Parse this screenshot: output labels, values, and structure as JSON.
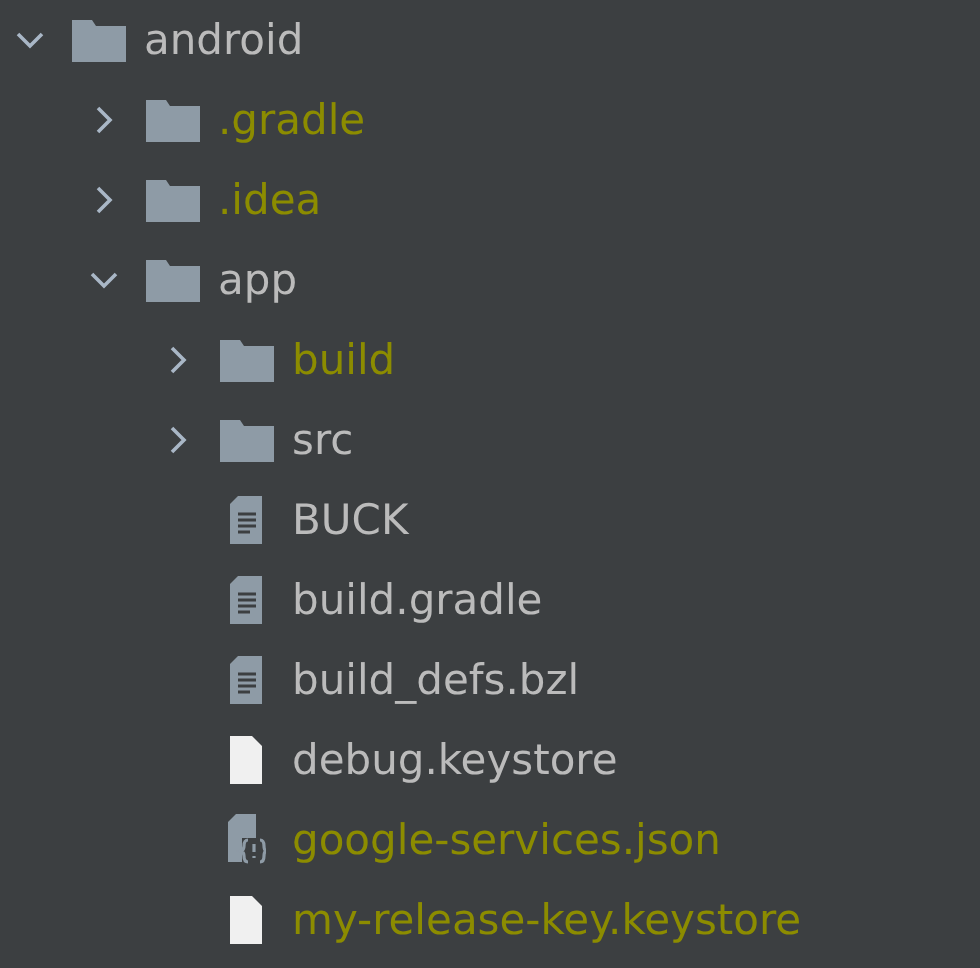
{
  "tree": [
    {
      "kind": "folder",
      "name": "android",
      "expanded": true,
      "ignored": false,
      "children": [
        {
          "kind": "folder",
          "name": ".gradle",
          "expanded": false,
          "ignored": true
        },
        {
          "kind": "folder",
          "name": ".idea",
          "expanded": false,
          "ignored": true
        },
        {
          "kind": "folder",
          "name": "app",
          "expanded": true,
          "ignored": false,
          "children": [
            {
              "kind": "folder",
              "name": "build",
              "expanded": false,
              "ignored": true
            },
            {
              "kind": "folder",
              "name": "src",
              "expanded": false,
              "ignored": false
            },
            {
              "kind": "text-file",
              "name": "BUCK",
              "ignored": false
            },
            {
              "kind": "text-file",
              "name": "build.gradle",
              "ignored": false
            },
            {
              "kind": "text-file",
              "name": "build_defs.bzl",
              "ignored": false
            },
            {
              "kind": "plain-file",
              "name": "debug.keystore",
              "ignored": false
            },
            {
              "kind": "json-file",
              "name": "google-services.json",
              "ignored": true
            },
            {
              "kind": "plain-file",
              "name": "my-release-key.keystore",
              "ignored": true
            }
          ]
        }
      ]
    }
  ]
}
